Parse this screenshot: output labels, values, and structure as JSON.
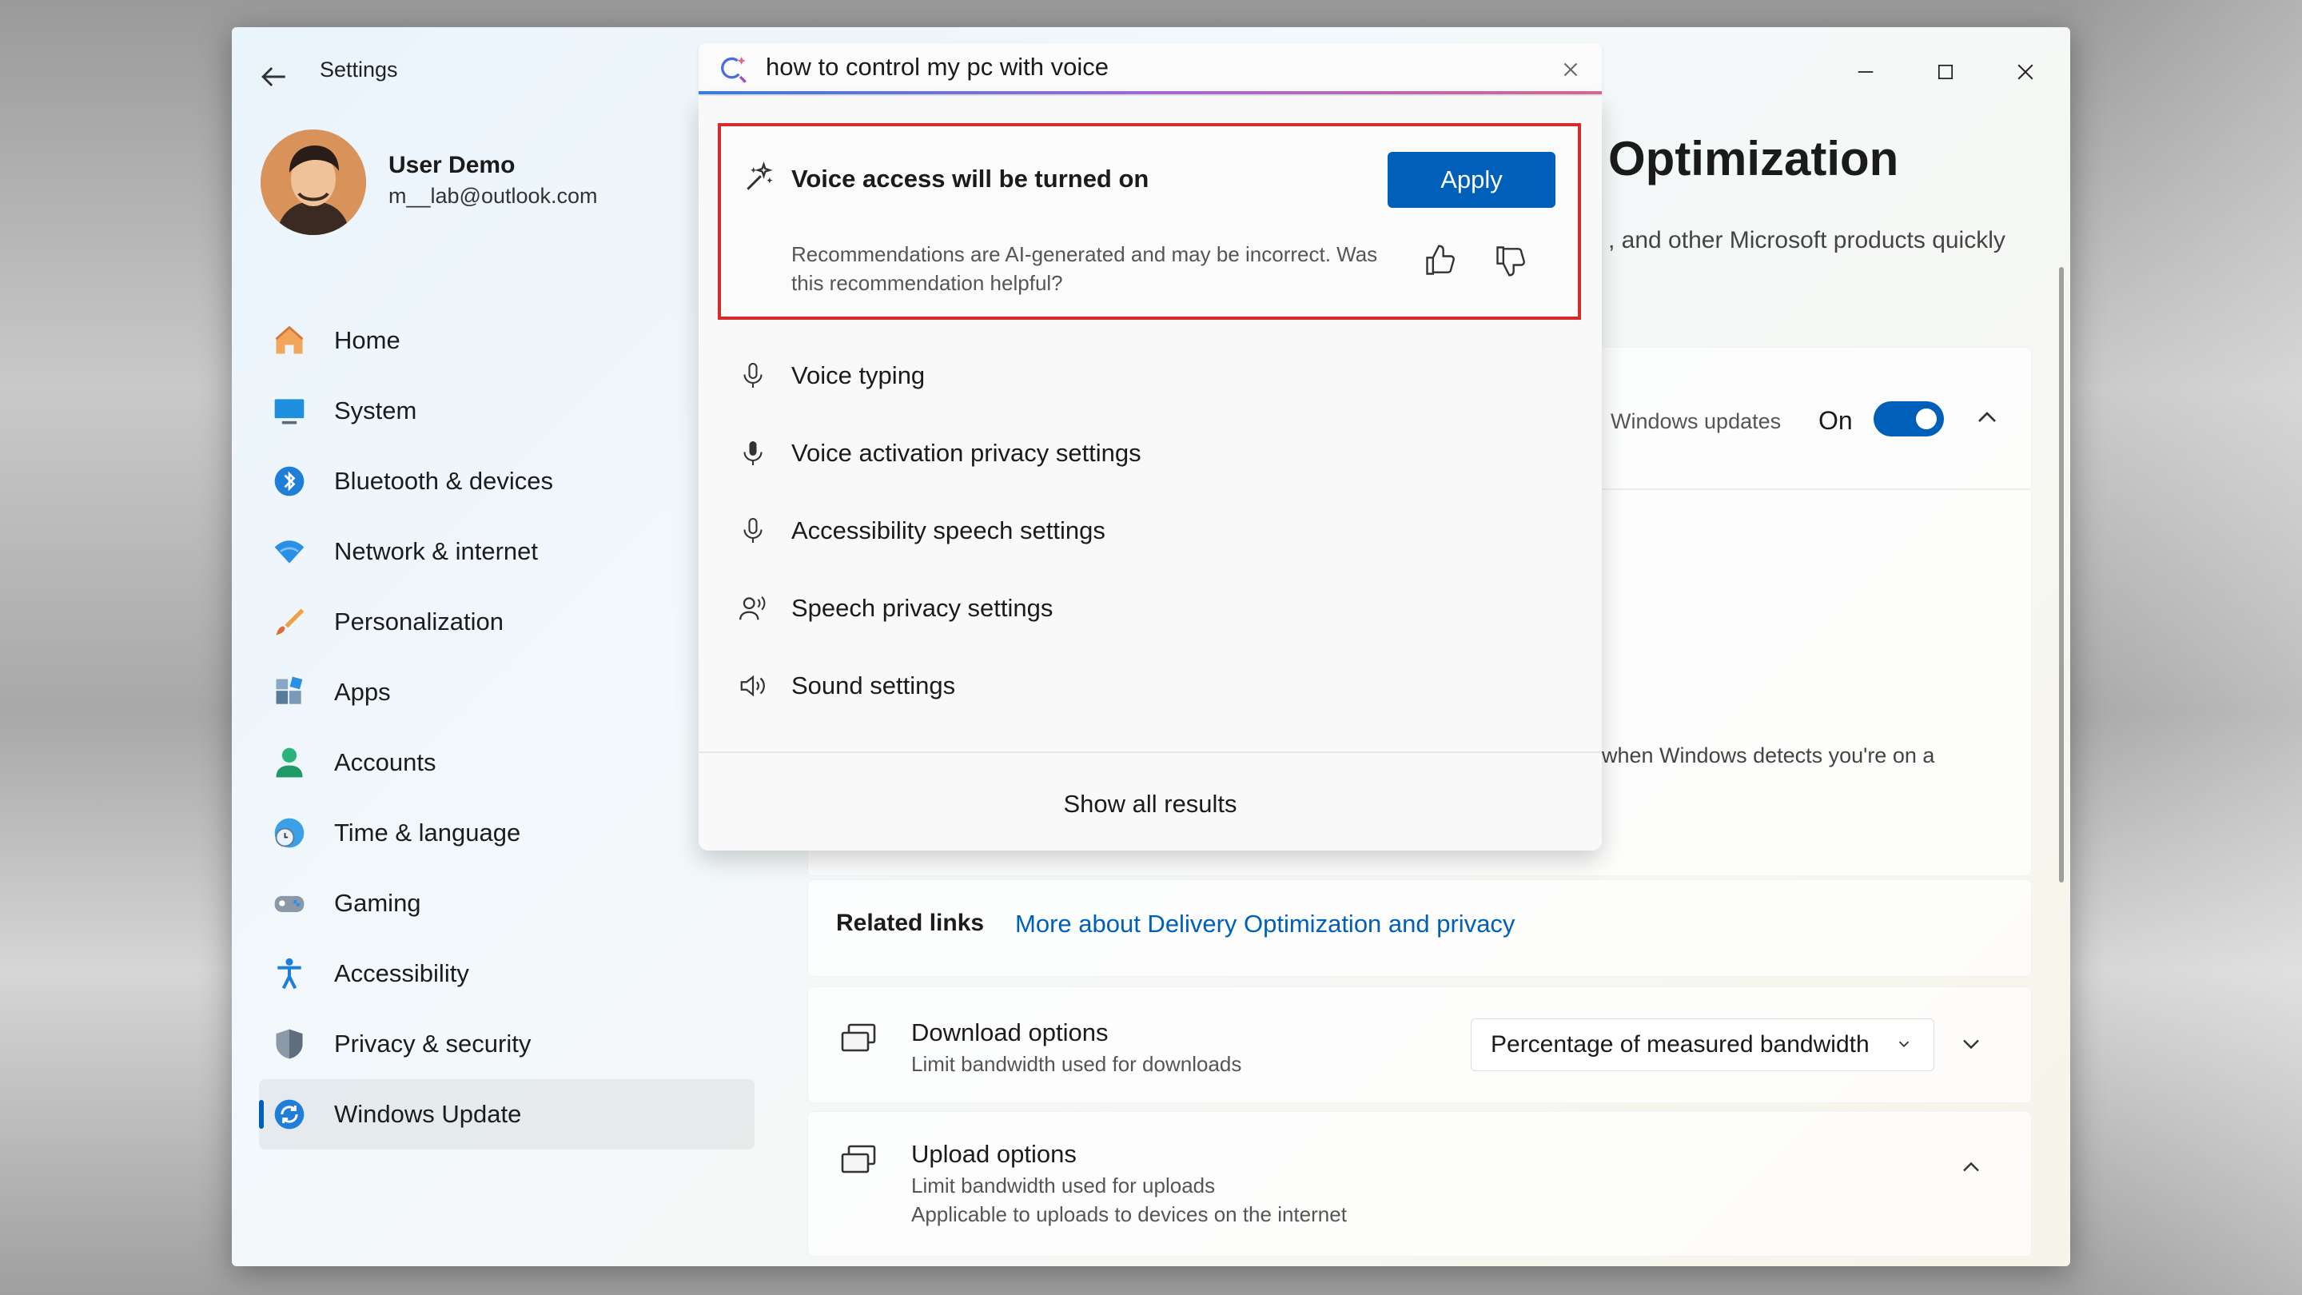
{
  "app": {
    "title": "Settings"
  },
  "user": {
    "name": "User Demo",
    "email": "m__lab@outlook.com"
  },
  "nav": {
    "items": [
      {
        "label": "Home",
        "icon": "home-icon"
      },
      {
        "label": "System",
        "icon": "monitor-icon"
      },
      {
        "label": "Bluetooth & devices",
        "icon": "bluetooth-icon"
      },
      {
        "label": "Network & internet",
        "icon": "wifi-icon"
      },
      {
        "label": "Personalization",
        "icon": "brush-icon"
      },
      {
        "label": "Apps",
        "icon": "apps-icon"
      },
      {
        "label": "Accounts",
        "icon": "person-icon"
      },
      {
        "label": "Time & language",
        "icon": "clock-globe-icon"
      },
      {
        "label": "Gaming",
        "icon": "gamepad-icon"
      },
      {
        "label": "Accessibility",
        "icon": "accessibility-icon"
      },
      {
        "label": "Privacy & security",
        "icon": "shield-icon"
      },
      {
        "label": "Windows Update",
        "icon": "update-icon"
      }
    ],
    "active": "Windows Update"
  },
  "search": {
    "value": "how to control my pc with voice"
  },
  "recommendation": {
    "title": "Voice access will be turned on",
    "apply_label": "Apply",
    "note": "Recommendations are AI-generated and may be incorrect. Was this recommendation helpful?"
  },
  "results": [
    {
      "label": "Voice typing",
      "icon": "microphone-icon"
    },
    {
      "label": "Voice activation privacy settings",
      "icon": "microphone-filled-icon"
    },
    {
      "label": "Accessibility speech settings",
      "icon": "microphone-icon"
    },
    {
      "label": "Speech privacy settings",
      "icon": "person-voice-icon"
    },
    {
      "label": "Sound settings",
      "icon": "speaker-icon"
    }
  ],
  "show_all_label": "Show all results",
  "page": {
    "heading": "Optimization",
    "description": ", and other Microsoft products quickly",
    "windows_updates_label": "Windows updates",
    "toggle_state": "On",
    "toggle_on": true,
    "metered_text": "when Windows detects you're on a",
    "related_links_label": "Related links",
    "related_link": "More about Delivery Optimization and privacy",
    "download": {
      "title": "Download options",
      "subtitle": "Limit bandwidth used for downloads",
      "selected": "Percentage of measured bandwidth"
    },
    "upload": {
      "title": "Upload options",
      "subtitle": "Limit bandwidth used for uploads",
      "subtitle2": "Applicable to uploads to devices on the internet"
    }
  },
  "colors": {
    "accent": "#005fb8",
    "highlight": "#d72b2b"
  }
}
